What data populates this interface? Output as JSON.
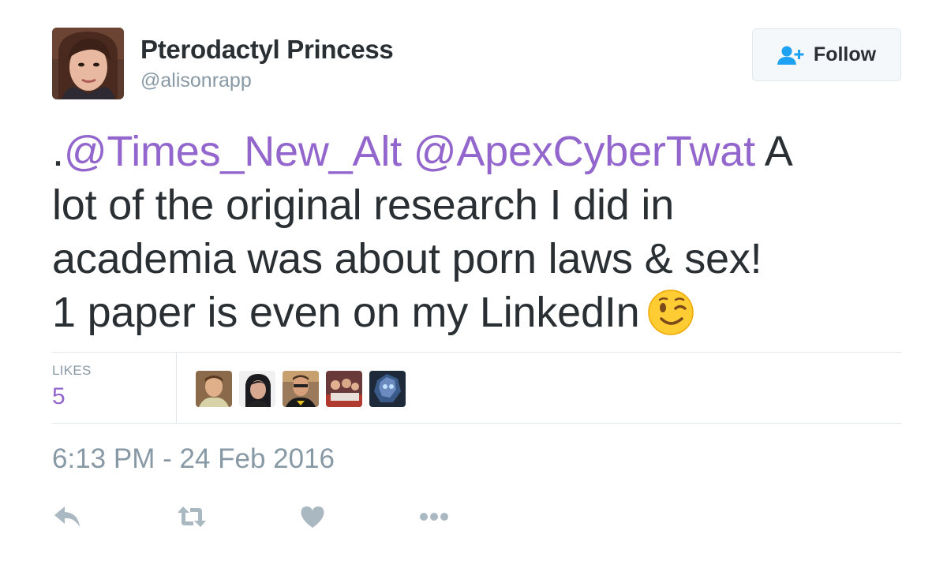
{
  "user": {
    "display_name": "Pterodactyl Princess",
    "handle": "@alisonrapp",
    "avatar_icon": "profile-photo"
  },
  "follow_button": {
    "label": "Follow",
    "icon": "follow-user-icon"
  },
  "tweet": {
    "lines": [
      [
        {
          "type": "text",
          "text": "."
        },
        {
          "type": "mention",
          "text": "@Times_New_Alt"
        },
        {
          "type": "text",
          "text": " "
        },
        {
          "type": "mention",
          "text": "@ApexCyberTwat"
        },
        {
          "type": "text",
          "text": " A"
        }
      ],
      [
        {
          "type": "text",
          "text": "lot of the original research I did in"
        }
      ],
      [
        {
          "type": "text",
          "text": "academia was about porn laws & sex!"
        }
      ],
      [
        {
          "type": "text",
          "text": "1 paper is even on my LinkedIn"
        },
        {
          "type": "emoji",
          "name": "winking-face-emoji"
        }
      ]
    ]
  },
  "stats": {
    "likes_label": "LIKES",
    "likes_count": "5",
    "likers": [
      {
        "name": "liker-avatar-1"
      },
      {
        "name": "liker-avatar-2"
      },
      {
        "name": "liker-avatar-3"
      },
      {
        "name": "liker-avatar-4"
      },
      {
        "name": "liker-avatar-5"
      }
    ]
  },
  "timestamp": "6:13 PM - 24 Feb 2016",
  "actions": [
    "reply-icon",
    "retweet-icon",
    "like-icon",
    "more-icon"
  ],
  "colors": {
    "mention": "#9266cc",
    "likes_count": "#9266cc",
    "muted": "#8899a6",
    "text": "#292f33",
    "follow_icon": "#1da1f2",
    "action_icon": "#aab8c2"
  }
}
